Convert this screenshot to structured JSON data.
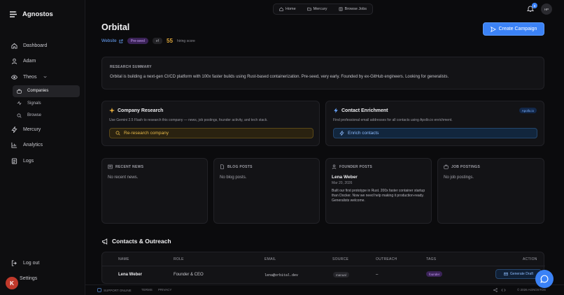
{
  "app": {
    "name": "Agnostos"
  },
  "sidebar": {
    "items": [
      {
        "label": "Dashboard",
        "icon": "home-icon"
      },
      {
        "label": "Adam",
        "icon": "user-icon"
      },
      {
        "label": "Theos",
        "icon": "eye-icon"
      },
      {
        "label": "Mercury",
        "icon": "bolt-icon"
      },
      {
        "label": "Analytics",
        "icon": "chart-icon"
      },
      {
        "label": "Logs",
        "icon": "log-icon"
      }
    ],
    "subitems": [
      {
        "label": "Companies",
        "icon": "briefcase-icon",
        "active": true
      },
      {
        "label": "Signals",
        "icon": "signal-icon"
      },
      {
        "label": "Browse",
        "icon": "search-icon"
      }
    ],
    "logout": "Log out",
    "settings": "Settings",
    "user_badge": "K"
  },
  "topnav": {
    "home": "Home",
    "mercury": "Mercury",
    "browse_jobs": "Browse Jobs"
  },
  "notifications": {
    "count": "6"
  },
  "user": {
    "initials": "HP"
  },
  "company": {
    "name": "Orbital",
    "website": "Website",
    "stage": "Pre-seed",
    "tag": "ef",
    "score": "55",
    "score_label": "hiring score",
    "create_campaign": "Create Campaign"
  },
  "research_summary": {
    "caption": "RESEARCH SUMMARY",
    "text": "Orbital is building a next-gen CI/CD platform with 100x faster builds using Rust-based containerization. Pre-seed, very early. Founded by ex-GitHub engineers. Looking for generalists."
  },
  "company_research": {
    "title": "Company Research",
    "desc": "Use Gemini 2.5 Flash to research this company — news, job postings, founder activity, and tech stack.",
    "button": "Re-research company"
  },
  "contact_enrichment": {
    "title": "Contact Enrichment",
    "badge": "Apollo.io",
    "desc": "Find professional email addresses for all contacts using Apollo.io enrichment.",
    "button": "Enrich contacts"
  },
  "panels": {
    "news": {
      "caption": "RECENT NEWS",
      "empty": "No recent news."
    },
    "blog": {
      "caption": "BLOG POSTS",
      "empty": "No blog posts."
    },
    "founder": {
      "caption": "FOUNDER POSTS",
      "author": "Lena Weber",
      "date": "Mar 20, 2026",
      "text": "Built our first prototype in Rust. 200x faster container startup than Docker. Now we need help making it production-ready. Generalists welcome."
    },
    "jobs": {
      "caption": "JOB POSTINGS",
      "empty": "No job postings."
    }
  },
  "contacts": {
    "title": "Contacts & Outreach",
    "headers": [
      "NAME",
      "ROLE",
      "EMAIL",
      "SOURCE",
      "OUTREACH",
      "TAGS",
      "ACTION"
    ],
    "rows": [
      {
        "name": "Lena Weber",
        "role": "Founder & CEO",
        "email": "lena@orbital.dev",
        "source": "manual",
        "outreach": "–",
        "tag": "founder",
        "action": "Generate Draft"
      }
    ]
  },
  "footer": {
    "status": "SUPPORT ONLINE",
    "terms": "TERMS",
    "privacy": "PRIVACY",
    "copyright": "© 2026 AGNOSTOS"
  },
  "colors": {
    "accent": "#3b82f6",
    "amber": "#e0a83a",
    "purple": "#c79cf5"
  }
}
